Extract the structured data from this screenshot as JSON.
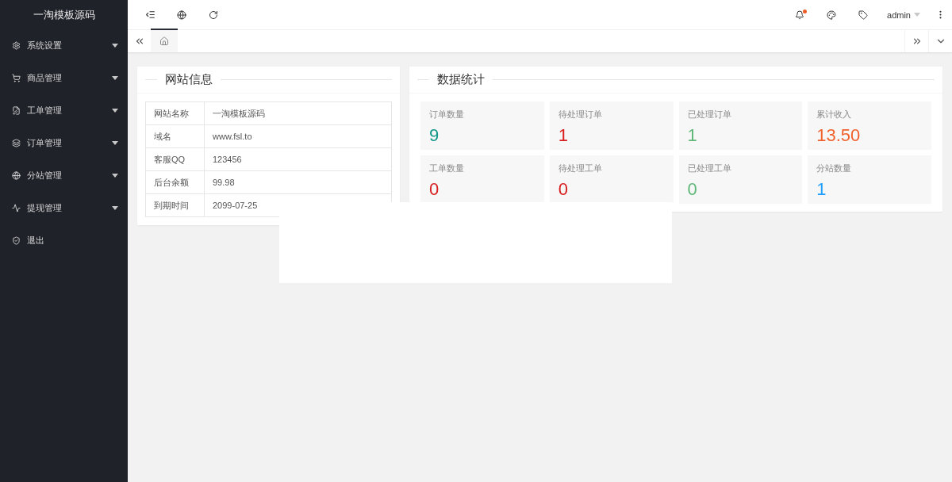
{
  "sidebar": {
    "logo": "一淘模板源码",
    "items": [
      {
        "label": "系统设置",
        "expandable": true
      },
      {
        "label": "商品管理",
        "expandable": true
      },
      {
        "label": "工单管理",
        "expandable": true
      },
      {
        "label": "订单管理",
        "expandable": true
      },
      {
        "label": "分站管理",
        "expandable": true
      },
      {
        "label": "提现管理",
        "expandable": true
      },
      {
        "label": "退出",
        "expandable": false
      }
    ]
  },
  "header": {
    "user": "admin",
    "notification_dot": true
  },
  "tabs": [
    {
      "selected": true
    }
  ],
  "site_info": {
    "title": "网站信息",
    "rows": [
      {
        "label": "网站名称",
        "value": "一淘模板源码"
      },
      {
        "label": "域名",
        "value": "www.fsl.to"
      },
      {
        "label": "客服QQ",
        "value": "123456"
      },
      {
        "label": "后台余额",
        "value": "99.98"
      },
      {
        "label": "到期时间",
        "value": "2099-07-25"
      }
    ]
  },
  "stats": {
    "title": "数据统计",
    "tiles": [
      {
        "label": "订单数量",
        "value": "9",
        "color": "#119688"
      },
      {
        "label": "待处理订单",
        "value": "1",
        "color": "#d81e1e"
      },
      {
        "label": "已处理订单",
        "value": "1",
        "color": "#5fb878"
      },
      {
        "label": "累计收入",
        "value": "13.50",
        "color": "#f0612b"
      },
      {
        "label": "工单数量",
        "value": "0",
        "color": "#d81e1e"
      },
      {
        "label": "待处理工单",
        "value": "0",
        "color": "#d81e1e"
      },
      {
        "label": "已处理工单",
        "value": "0",
        "color": "#5fb878"
      },
      {
        "label": "分站数量",
        "value": "1",
        "color": "#1e9fff"
      }
    ]
  }
}
